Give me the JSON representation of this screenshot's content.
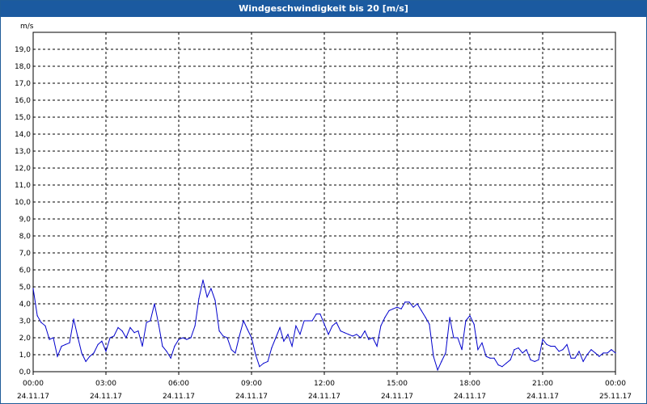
{
  "window": {
    "title": "Windgeschwindigkeit bis 20 [m/s]"
  },
  "colors": {
    "titlebar": "#1b5aa0",
    "series": "#0000cc",
    "grid": "#000000"
  },
  "chart_data": {
    "type": "line",
    "title": "Windgeschwindigkeit bis 20 [m/s]",
    "ylabel": "m/s",
    "xlabel": "",
    "ylim": [
      0,
      20
    ],
    "xlim_hours": [
      0,
      24
    ],
    "grid": true,
    "y_ticks": [
      "0,0",
      "1,0",
      "2,0",
      "3,0",
      "4,0",
      "5,0",
      "6,0",
      "7,0",
      "8,0",
      "9,0",
      "10,0",
      "11,0",
      "12,0",
      "13,0",
      "14,0",
      "15,0",
      "16,0",
      "17,0",
      "18,0",
      "19,0"
    ],
    "x_ticks": [
      {
        "time": "00:00",
        "date": "24.11.17"
      },
      {
        "time": "03:00",
        "date": "24.11.17"
      },
      {
        "time": "06:00",
        "date": "24.11.17"
      },
      {
        "time": "09:00",
        "date": "24.11.17"
      },
      {
        "time": "12:00",
        "date": "24.11.17"
      },
      {
        "time": "15:00",
        "date": "24.11.17"
      },
      {
        "time": "18:00",
        "date": "24.11.17"
      },
      {
        "time": "21:00",
        "date": "24.11.17"
      },
      {
        "time": "00:00",
        "date": "25.11.17"
      }
    ],
    "series": [
      {
        "values": [
          [
            0.0,
            4.9
          ],
          [
            0.17,
            3.3
          ],
          [
            0.33,
            2.9
          ],
          [
            0.5,
            2.7
          ],
          [
            0.67,
            1.9
          ],
          [
            0.83,
            2.0
          ],
          [
            1.0,
            0.9
          ],
          [
            1.17,
            1.5
          ],
          [
            1.33,
            1.6
          ],
          [
            1.5,
            1.7
          ],
          [
            1.67,
            3.1
          ],
          [
            1.83,
            2.1
          ],
          [
            2.0,
            1.1
          ],
          [
            2.17,
            0.6
          ],
          [
            2.33,
            0.9
          ],
          [
            2.5,
            1.1
          ],
          [
            2.67,
            1.6
          ],
          [
            2.83,
            1.8
          ],
          [
            3.0,
            1.2
          ],
          [
            3.17,
            2.0
          ],
          [
            3.33,
            2.1
          ],
          [
            3.5,
            2.6
          ],
          [
            3.67,
            2.4
          ],
          [
            3.83,
            2.0
          ],
          [
            4.0,
            2.6
          ],
          [
            4.17,
            2.3
          ],
          [
            4.33,
            2.4
          ],
          [
            4.5,
            1.5
          ],
          [
            4.67,
            2.9
          ],
          [
            4.83,
            3.0
          ],
          [
            5.0,
            4.0
          ],
          [
            5.17,
            2.8
          ],
          [
            5.33,
            1.5
          ],
          [
            5.5,
            1.2
          ],
          [
            5.67,
            0.8
          ],
          [
            5.83,
            1.5
          ],
          [
            6.0,
            1.9
          ],
          [
            6.17,
            2.0
          ],
          [
            6.33,
            1.9
          ],
          [
            6.5,
            2.0
          ],
          [
            6.67,
            2.7
          ],
          [
            6.83,
            4.3
          ],
          [
            7.0,
            5.4
          ],
          [
            7.17,
            4.4
          ],
          [
            7.33,
            4.9
          ],
          [
            7.5,
            4.2
          ],
          [
            7.67,
            2.4
          ],
          [
            7.83,
            2.1
          ],
          [
            8.0,
            2.0
          ],
          [
            8.17,
            1.3
          ],
          [
            8.33,
            1.1
          ],
          [
            8.5,
            2.1
          ],
          [
            8.67,
            3.0
          ],
          [
            8.83,
            2.5
          ],
          [
            9.0,
            2.0
          ],
          [
            9.17,
            1.0
          ],
          [
            9.33,
            0.3
          ],
          [
            9.5,
            0.5
          ],
          [
            9.67,
            0.6
          ],
          [
            9.83,
            1.4
          ],
          [
            10.0,
            2.0
          ],
          [
            10.17,
            2.6
          ],
          [
            10.33,
            1.8
          ],
          [
            10.5,
            2.2
          ],
          [
            10.67,
            1.5
          ],
          [
            10.83,
            2.7
          ],
          [
            11.0,
            2.2
          ],
          [
            11.17,
            3.0
          ],
          [
            11.33,
            3.0
          ],
          [
            11.5,
            3.0
          ],
          [
            11.67,
            3.4
          ],
          [
            11.83,
            3.4
          ],
          [
            12.0,
            2.8
          ],
          [
            12.17,
            2.2
          ],
          [
            12.33,
            2.7
          ],
          [
            12.5,
            2.9
          ],
          [
            12.67,
            2.4
          ],
          [
            12.83,
            2.3
          ],
          [
            13.0,
            2.2
          ],
          [
            13.17,
            2.1
          ],
          [
            13.33,
            2.2
          ],
          [
            13.5,
            2.0
          ],
          [
            13.67,
            2.4
          ],
          [
            13.83,
            1.9
          ],
          [
            14.0,
            2.0
          ],
          [
            14.17,
            1.5
          ],
          [
            14.33,
            2.7
          ],
          [
            14.5,
            3.2
          ],
          [
            14.67,
            3.6
          ],
          [
            14.83,
            3.7
          ],
          [
            15.0,
            3.8
          ],
          [
            15.17,
            3.7
          ],
          [
            15.33,
            4.1
          ],
          [
            15.5,
            4.1
          ],
          [
            15.67,
            3.8
          ],
          [
            15.83,
            4.0
          ],
          [
            16.0,
            3.6
          ],
          [
            16.17,
            3.2
          ],
          [
            16.33,
            2.8
          ],
          [
            16.5,
            0.9
          ],
          [
            16.67,
            0.1
          ],
          [
            16.83,
            0.6
          ],
          [
            17.0,
            1.1
          ],
          [
            17.17,
            3.2
          ],
          [
            17.33,
            2.0
          ],
          [
            17.5,
            2.0
          ],
          [
            17.67,
            1.3
          ],
          [
            17.83,
            3.0
          ],
          [
            18.0,
            3.3
          ],
          [
            18.17,
            2.8
          ],
          [
            18.33,
            1.3
          ],
          [
            18.5,
            1.7
          ],
          [
            18.67,
            0.9
          ],
          [
            18.83,
            0.8
          ],
          [
            19.0,
            0.8
          ],
          [
            19.17,
            0.4
          ],
          [
            19.33,
            0.3
          ],
          [
            19.5,
            0.5
          ],
          [
            19.67,
            0.7
          ],
          [
            19.83,
            1.3
          ],
          [
            20.0,
            1.4
          ],
          [
            20.17,
            1.1
          ],
          [
            20.33,
            1.3
          ],
          [
            20.5,
            0.7
          ],
          [
            20.67,
            0.6
          ],
          [
            20.83,
            0.7
          ],
          [
            21.0,
            1.9
          ],
          [
            21.17,
            1.6
          ],
          [
            21.33,
            1.5
          ],
          [
            21.5,
            1.5
          ],
          [
            21.67,
            1.2
          ],
          [
            21.83,
            1.3
          ],
          [
            22.0,
            1.6
          ],
          [
            22.17,
            0.8
          ],
          [
            22.33,
            0.8
          ],
          [
            22.5,
            1.2
          ],
          [
            22.67,
            0.6
          ],
          [
            22.83,
            1.0
          ],
          [
            23.0,
            1.3
          ],
          [
            23.17,
            1.1
          ],
          [
            23.33,
            0.9
          ],
          [
            23.5,
            1.1
          ],
          [
            23.67,
            1.1
          ],
          [
            23.83,
            1.3
          ],
          [
            24.0,
            1.1
          ]
        ]
      }
    ]
  }
}
